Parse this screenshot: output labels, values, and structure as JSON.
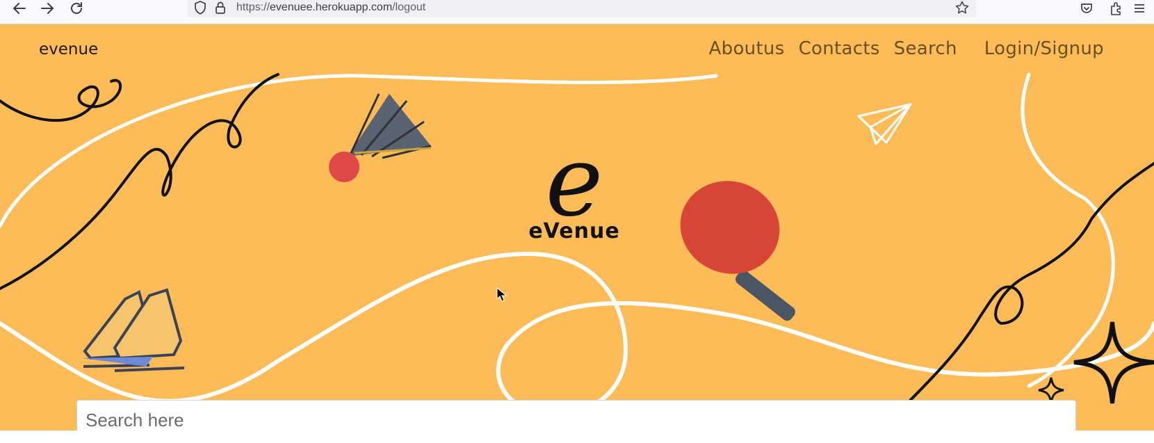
{
  "browser": {
    "url_prefix": "https://",
    "url_host": "evenuee.herokuapp.com",
    "url_path": "/logout"
  },
  "header": {
    "brand": "evenue",
    "nav": [
      "Aboutus",
      "Contacts",
      "Search",
      "Login/Signup"
    ]
  },
  "hero": {
    "logo_letter": "e",
    "logo_name": "eVenue"
  },
  "search": {
    "placeholder": "Search here",
    "value": ""
  },
  "colors": {
    "page_background": "#fdbc58",
    "nav_text": "#6a4f1e",
    "paddle_red": "#d64535",
    "handle_gray": "#4a5565",
    "shuttle_tip": "#e04848"
  }
}
